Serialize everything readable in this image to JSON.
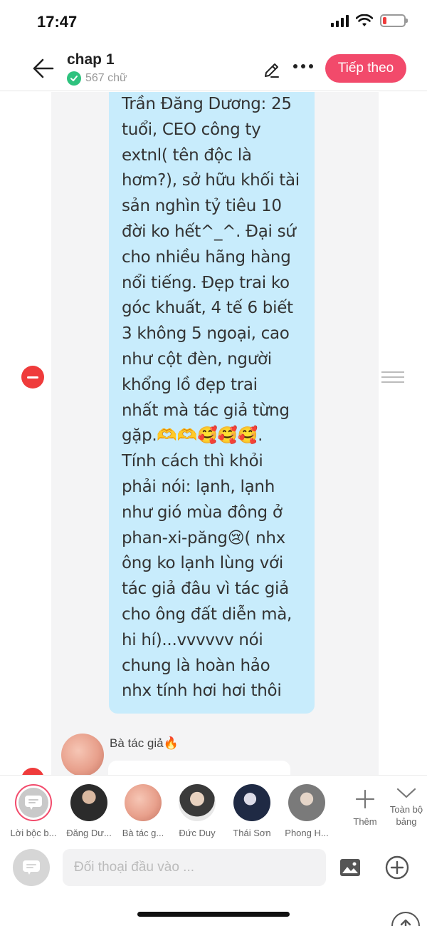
{
  "status_bar": {
    "time": "17:47",
    "battery_level": 0.18
  },
  "header": {
    "title": "chap 1",
    "word_count": "567 chữ",
    "next_label": "Tiếp theo",
    "accent_color": "#f24a6b"
  },
  "message": {
    "text": "Trần Đăng Dương: 25\ntuổi, CEO công ty\nextnl( tên độc là\nhơm?), sở hữu khối tài\nsản nghìn tỷ tiêu 10\nđời ko hết^_^. Đại sứ\ncho nhiều hãng hàng\nnổi tiếng. Đẹp trai ko\ngóc khuất, 4 tế 6 biết\n3 không 5 ngoại, cao\nnhư cột đèn, người\nkhổng lồ đẹp trai\nnhất mà tác giả từng\ngặp.🫶🫶🥰🥰🥰.\nTính cách thì khỏi\nphải nói: lạnh, lạnh\nnhư gió mùa đông ở\nphan-xi-păng😢( nhx\nông ko lạnh lùng với\ntác giả đâu vì tác giả\ncho ông đất diễn mà,\nhi hí)...vvvvvv nói\nchung là hoàn hảo\nnhx tính hơi hơi thôi",
    "bubble_color": "#c8ecfc"
  },
  "next_message": {
    "speaker": "Bà tác giả🔥"
  },
  "characters": [
    {
      "name": "Lời bộc b...",
      "type": "narrator",
      "selected": true
    },
    {
      "name": "Đăng Dư...",
      "type": "avatar",
      "color": "#2b2b2b"
    },
    {
      "name": "Bà tác g...",
      "type": "avatar",
      "color": "#e8a08c"
    },
    {
      "name": "Đức Duy",
      "type": "avatar",
      "color": "#3a3a3a"
    },
    {
      "name": "Thái Sơn",
      "type": "avatar",
      "color": "#1f2a44"
    },
    {
      "name": "Phong H...",
      "type": "avatar",
      "color": "#7a7a7a"
    }
  ],
  "add_character_label": "Thêm",
  "expand_label": "Toàn bộ bảng",
  "input": {
    "placeholder": "Đối thoại đầu vào ..."
  }
}
